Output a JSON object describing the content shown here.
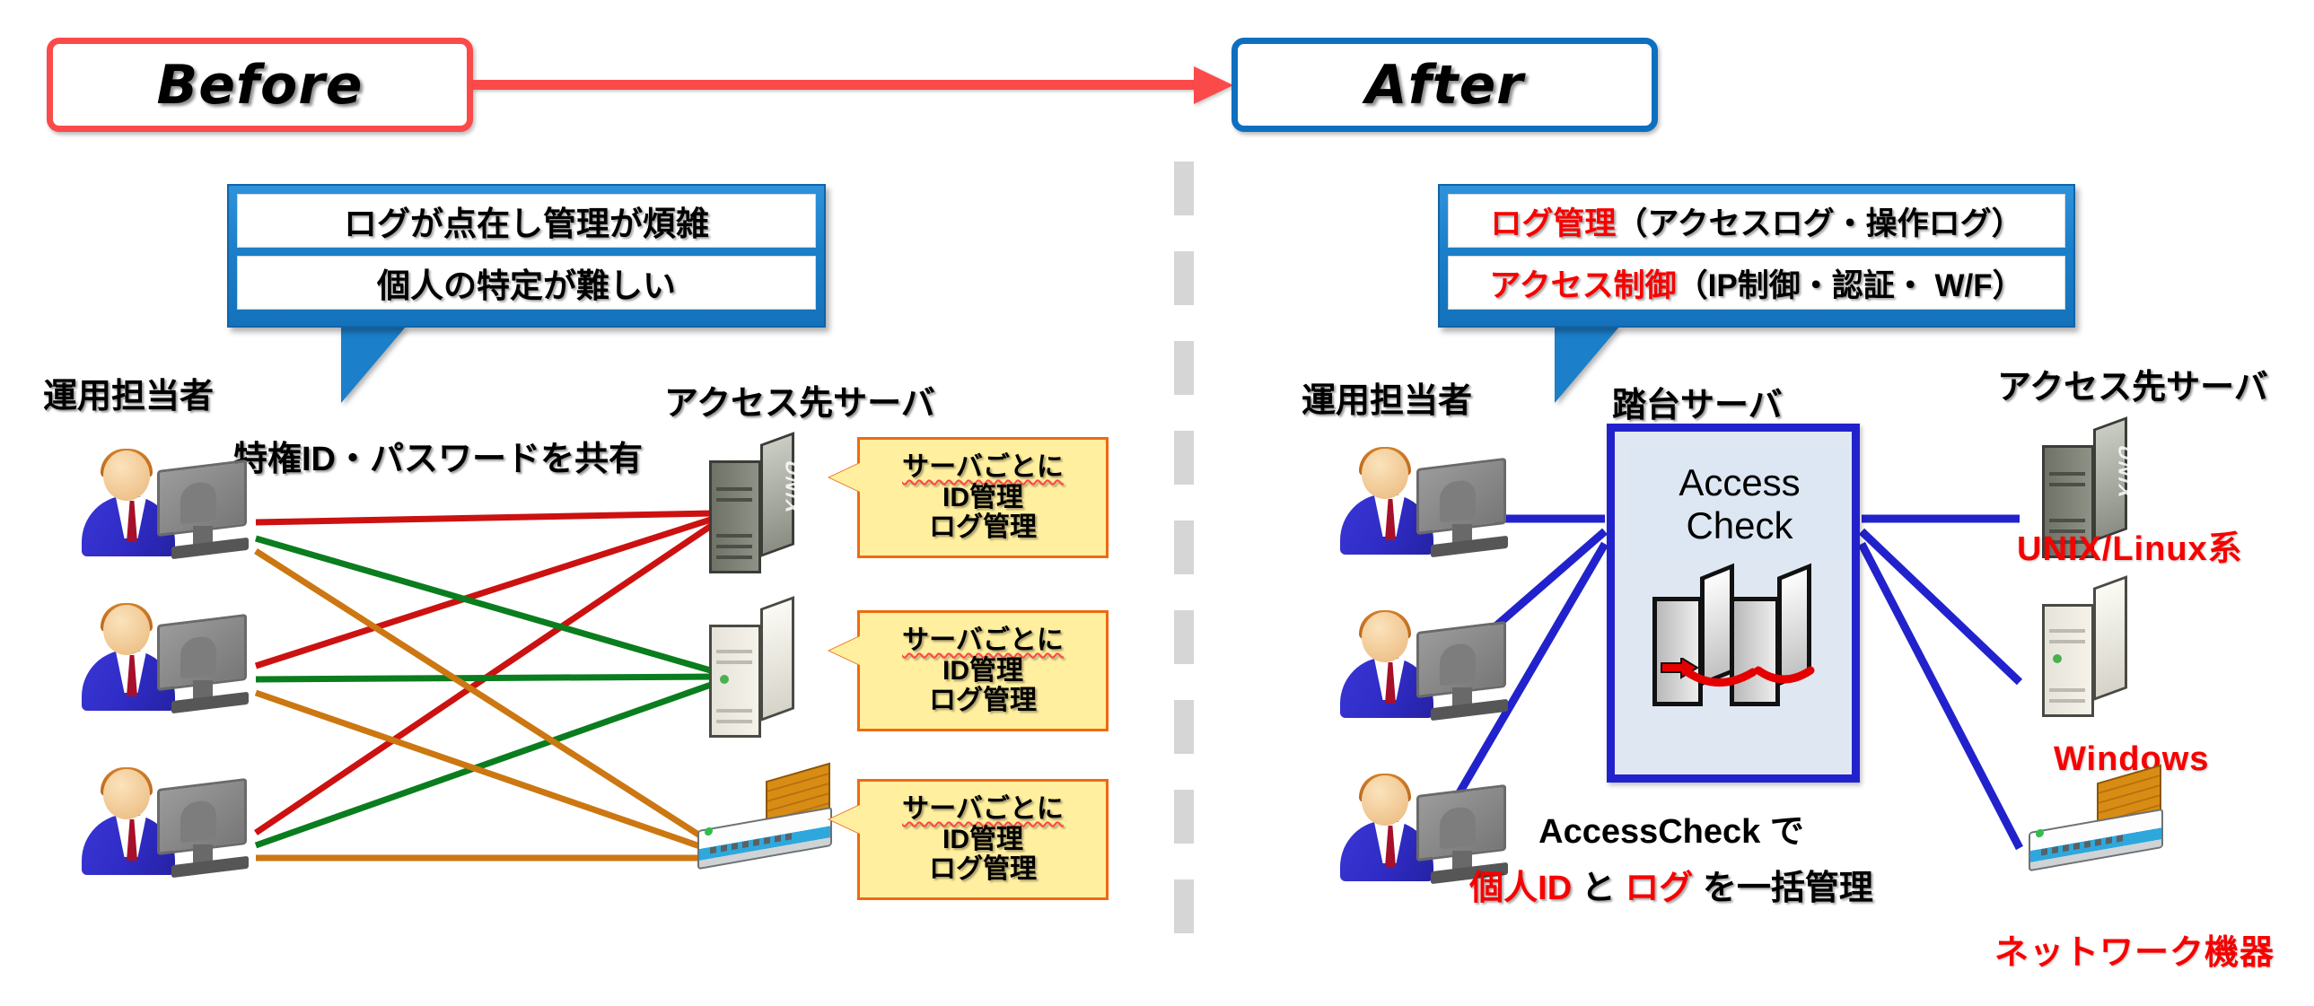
{
  "phases": {
    "before_label": "Before",
    "after_label": "After",
    "before_color": "#fb4a4a",
    "after_color": "#0d6fc0",
    "arrow_color": "#fb4a4a"
  },
  "callout_left": {
    "rows": [
      {
        "text": "ログが点在し管理が煩雑"
      },
      {
        "text": "個人の特定が難しい"
      }
    ]
  },
  "callout_right": {
    "rows": [
      {
        "highlight": "ログ管理",
        "rest": "（アクセスログ・操作ログ）"
      },
      {
        "highlight": "アクセス制御",
        "rest": "（IP制御・認証・ W/F）"
      }
    ],
    "highlight_color": "#f80000"
  },
  "before_section": {
    "operators_label": "運用担当者",
    "target_servers_label": "アクセス先サーバ",
    "share_label": "特権ID・パスワードを共有",
    "notes": [
      {
        "line1": "サーバごとに",
        "line2": "ID管理",
        "line3": "ログ管理"
      },
      {
        "line1": "サーバごとに",
        "line2": "ID管理",
        "line3": "ログ管理"
      },
      {
        "line1": "サーバごとに",
        "line2": "ID管理",
        "line3": "ログ管理"
      }
    ],
    "note_fill": "#ffef9f",
    "note_border": "#ef6a10",
    "link_colors": [
      "#cc1111",
      "#0a7d1e",
      "#cc7711"
    ]
  },
  "after_section": {
    "operators_label": "運用担当者",
    "step_server_label": "踏台サーバ",
    "step_server_product_line1": "Access",
    "step_server_product_line2": "Check",
    "target_servers_label": "アクセス先サーバ",
    "server_labels": [
      {
        "text": "UNIX/Linux系"
      },
      {
        "text": "Windows"
      },
      {
        "text": "ネットワーク機器"
      }
    ],
    "server_label_color": "#f80000",
    "link_color": "#2222cc",
    "summary_line1": "AccessCheck で",
    "summary_line2_parts": [
      {
        "text": "個人ID",
        "highlight": true
      },
      {
        "text": " と ",
        "highlight": false
      },
      {
        "text": "ログ",
        "highlight": true
      },
      {
        "text": " を一括管理",
        "highlight": false
      }
    ]
  },
  "icons": {
    "unix_server_badge": "UNIX",
    "operator": "person-at-computer-icon",
    "divider": "vertical-dashed-divider"
  }
}
